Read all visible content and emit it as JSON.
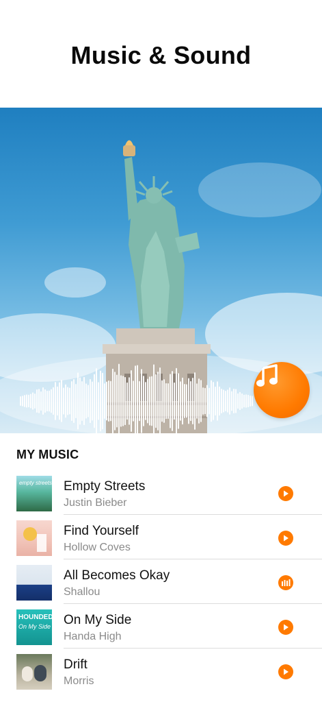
{
  "header": {
    "title": "Music & Sound"
  },
  "hero": {
    "image": "statue-of-liberty-sky",
    "fab_icon": "music-note-icon",
    "accent": "#ff7a00"
  },
  "section": {
    "title": "MY MUSIC"
  },
  "tracks": [
    {
      "title": "Empty Streets",
      "artist": "Justin Bieber",
      "action_icon": "play-icon",
      "cover_colors": [
        "#57b8a0",
        "#3a6b42"
      ]
    },
    {
      "title": "Find Yourself",
      "artist": "Hollow  Coves",
      "action_icon": "play-icon",
      "cover_colors": [
        "#f3c8bf",
        "#f4c14a"
      ]
    },
    {
      "title": "All Becomes Okay",
      "artist": "Shallou",
      "action_icon": "equalizer-icon",
      "cover_colors": [
        "#dfe8f2",
        "#1b3f86"
      ]
    },
    {
      "title": "On My Side",
      "artist": "Handa High",
      "action_icon": "play-icon",
      "cover_colors": [
        "#23b6b2",
        "#0f7c7a"
      ]
    },
    {
      "title": "Drift",
      "artist": "Morris",
      "action_icon": "play-icon",
      "cover_colors": [
        "#7f7d6a",
        "#c9c3b2"
      ]
    }
  ]
}
